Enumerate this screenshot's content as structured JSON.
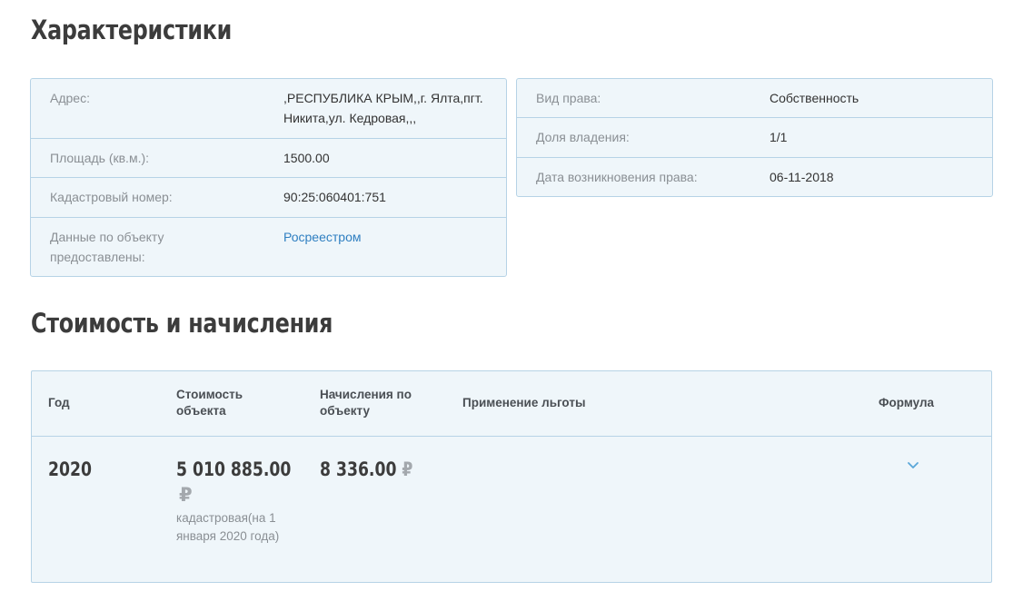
{
  "characteristics": {
    "title": "Характеристики",
    "left_rows": [
      {
        "label": "Адрес:",
        "value": ",РЕСПУБЛИКА КРЫМ,,г. Ялта,пгт. Никита,ул. Кедровая,,,"
      },
      {
        "label": "Площадь (кв.м.):",
        "value": "1500.00"
      },
      {
        "label": "Кадастровый номер:",
        "value": "90:25:060401:751"
      },
      {
        "label": "Данные по объекту предоставлены:",
        "value": "Росреестром"
      }
    ],
    "right_rows": [
      {
        "label": "Вид права:",
        "value": "Собственность"
      },
      {
        "label": "Доля владения:",
        "value": "1/1"
      },
      {
        "label": "Дата возникновения права:",
        "value": "06-11-2018"
      }
    ]
  },
  "costs": {
    "title": "Стоимость и начисления",
    "headers": {
      "year": "Год",
      "cost": "Стоимость объекта",
      "accrual": "Начисления по объекту",
      "benefit": "Применение льготы",
      "formula": "Формула"
    },
    "row": {
      "year": "2020",
      "cost": "5 010 885.00",
      "cost_note": "кадастровая(на 1 января 2020 года)",
      "accrual": "8 336.00",
      "currency": "₽"
    }
  },
  "icons": {
    "expand": "chevron-down-icon"
  },
  "colors": {
    "panel_bg": "#eff6fa",
    "panel_border": "#b6d3e6",
    "link": "#2f7fc1",
    "chevron": "#5aa7d8"
  }
}
